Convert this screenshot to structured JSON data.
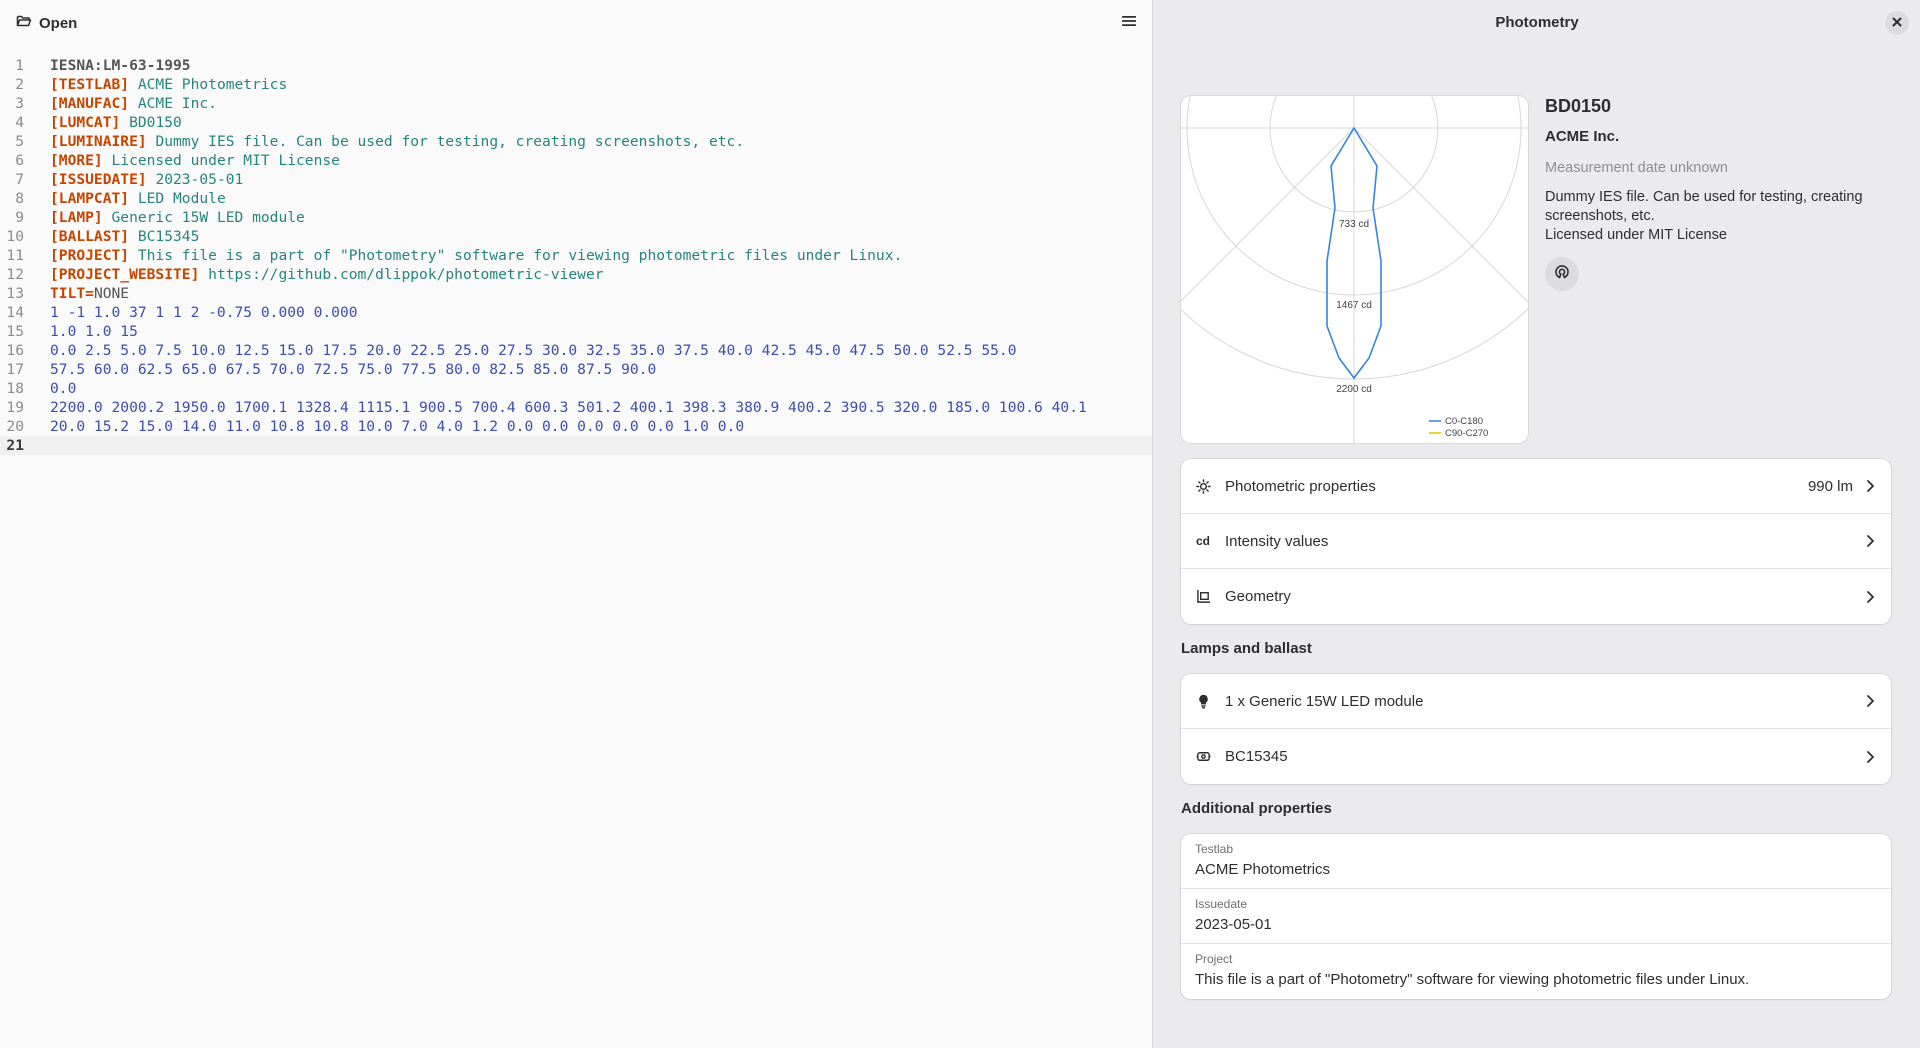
{
  "header": {
    "open_label": "Open"
  },
  "editor": {
    "current_line": 21,
    "lines": [
      [
        {
          "t": "IESNA:LM-63-1995",
          "c": "hdr"
        }
      ],
      [
        {
          "t": "[TESTLAB]",
          "c": "kw"
        },
        {
          "t": " ACME Photometrics",
          "c": "val"
        }
      ],
      [
        {
          "t": "[MANUFAC]",
          "c": "kw"
        },
        {
          "t": " ACME Inc.",
          "c": "val"
        }
      ],
      [
        {
          "t": "[LUMCAT]",
          "c": "kw"
        },
        {
          "t": " BD0150",
          "c": "val"
        }
      ],
      [
        {
          "t": "[LUMINAIRE]",
          "c": "kw"
        },
        {
          "t": " Dummy IES file. Can be used for testing, creating screenshots, etc.",
          "c": "val"
        }
      ],
      [
        {
          "t": "[MORE]",
          "c": "kw"
        },
        {
          "t": " Licensed under MIT License",
          "c": "val"
        }
      ],
      [
        {
          "t": "[ISSUEDATE]",
          "c": "kw"
        },
        {
          "t": " 2023-05-01",
          "c": "val"
        }
      ],
      [
        {
          "t": "[LAMPCAT]",
          "c": "kw"
        },
        {
          "t": " LED Module",
          "c": "val"
        }
      ],
      [
        {
          "t": "[LAMP]",
          "c": "kw"
        },
        {
          "t": " Generic 15W LED module",
          "c": "val"
        }
      ],
      [
        {
          "t": "[BALLAST]",
          "c": "kw"
        },
        {
          "t": " BC15345",
          "c": "val"
        }
      ],
      [
        {
          "t": "[PROJECT]",
          "c": "kw"
        },
        {
          "t": " This file is a part of \"Photometry\" software for viewing photometric files under Linux.",
          "c": "val"
        }
      ],
      [
        {
          "t": "[PROJECT_WEBSITE]",
          "c": "kw"
        },
        {
          "t": " https://github.com/dlippok/photometric-viewer",
          "c": "val"
        }
      ],
      [
        {
          "t": "TILT=",
          "c": "kw"
        },
        {
          "t": "NONE",
          "c": "plain"
        }
      ],
      [
        {
          "t": "1 -1 1.0 37 1 1 2 -0.75 0.000 0.000",
          "c": "num"
        }
      ],
      [
        {
          "t": "1.0 1.0 15",
          "c": "num"
        }
      ],
      [
        {
          "t": "0.0 2.5 5.0 7.5 10.0 12.5 15.0 17.5 20.0 22.5 25.0 27.5 30.0 32.5 35.0 37.5 40.0 42.5 45.0 47.5 50.0 52.5 55.0",
          "c": "num"
        }
      ],
      [
        {
          "t": "57.5 60.0 62.5 65.0 67.5 70.0 72.5 75.0 77.5 80.0 82.5 85.0 87.5 90.0",
          "c": "num"
        }
      ],
      [
        {
          "t": "0.0",
          "c": "num"
        }
      ],
      [
        {
          "t": "2200.0 2000.2 1950.0 1700.1 1328.4 1115.1 900.5 700.4 600.3 501.2 400.1 398.3 380.9 400.2 390.5 320.0 185.0 100.6 40.1",
          "c": "num"
        }
      ],
      [
        {
          "t": "20.0 15.2 15.0 14.0 11.0 10.8 10.8 10.0 7.0 4.0 1.2 0.0 0.0 0.0 0.0 0.0 1.0 0.0",
          "c": "num"
        }
      ],
      []
    ]
  },
  "panel": {
    "title": "Photometry",
    "diagram": {
      "ring_labels": [
        "733 cd",
        "1467 cd",
        "2200 cd"
      ],
      "legend": [
        "C0-C180",
        "C90-C270"
      ],
      "colors": {
        "c0": "#3584e4",
        "c90": "#e5c000"
      }
    },
    "luminaire": {
      "name": "BD0150",
      "manufacturer": "ACME Inc.",
      "date": "Measurement date unknown",
      "description_1": "Dummy IES file. Can be used for testing, creating screenshots, etc.",
      "description_2": "Licensed under MIT License"
    },
    "main_rows": [
      {
        "icon": "sun-icon",
        "label": "Photometric properties",
        "suffix": "990 lm"
      },
      {
        "icon": "cd",
        "label": "Intensity values",
        "suffix": ""
      },
      {
        "icon": "geometry-icon",
        "label": "Geometry",
        "suffix": ""
      }
    ],
    "lamps_title": "Lamps and ballast",
    "lamp_rows": [
      {
        "icon": "bulb-icon",
        "label": "1 x Generic 15W LED module"
      },
      {
        "icon": "ballast-icon",
        "label": "BC15345"
      }
    ],
    "additional_title": "Additional properties",
    "additional": [
      {
        "key": "Testlab",
        "value": "ACME Photometrics"
      },
      {
        "key": "Issuedate",
        "value": "2023-05-01"
      },
      {
        "key": "Project",
        "value": "This file is a part of \"Photometry\" software for viewing photometric files under Linux."
      }
    ]
  }
}
